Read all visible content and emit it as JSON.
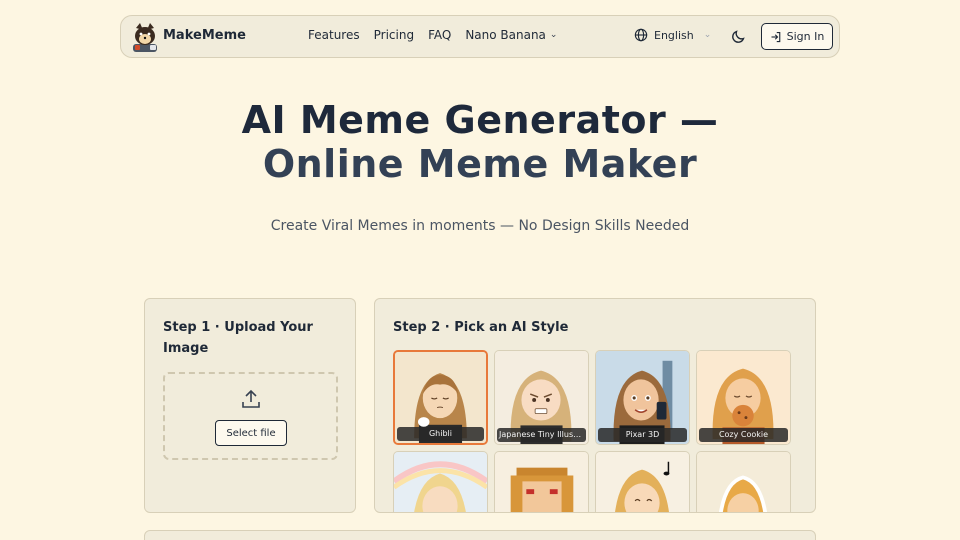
{
  "nav": {
    "brand": "MakeMeme",
    "links": [
      "Features",
      "Pricing",
      "FAQ"
    ],
    "dropdown": "Nano Banana",
    "language": "English",
    "signin": "Sign In"
  },
  "hero": {
    "title_line1": "AI Meme Generator —",
    "title_line2": "Online Meme Maker",
    "subtitle": "Create Viral Memes in moments — No Design Skills Needed"
  },
  "step1": {
    "title": "Step 1 · Upload Your Image",
    "button": "Select file"
  },
  "step2": {
    "title": "Step 2 · Pick an AI Style",
    "styles": [
      {
        "label": "Ghibli",
        "selected": true
      },
      {
        "label": "Japanese Tiny Illustration",
        "selected": false
      },
      {
        "label": "Pixar 3D",
        "selected": false
      },
      {
        "label": "Cozy Cookie",
        "selected": false
      },
      {
        "label": "",
        "selected": false
      },
      {
        "label": "",
        "selected": false
      },
      {
        "label": "",
        "selected": false
      },
      {
        "label": "",
        "selected": false
      }
    ]
  },
  "colors": {
    "background": "#fdf6e2",
    "card": "#f1ecdb",
    "accent": "#e8793a",
    "text": "#1e293b"
  }
}
